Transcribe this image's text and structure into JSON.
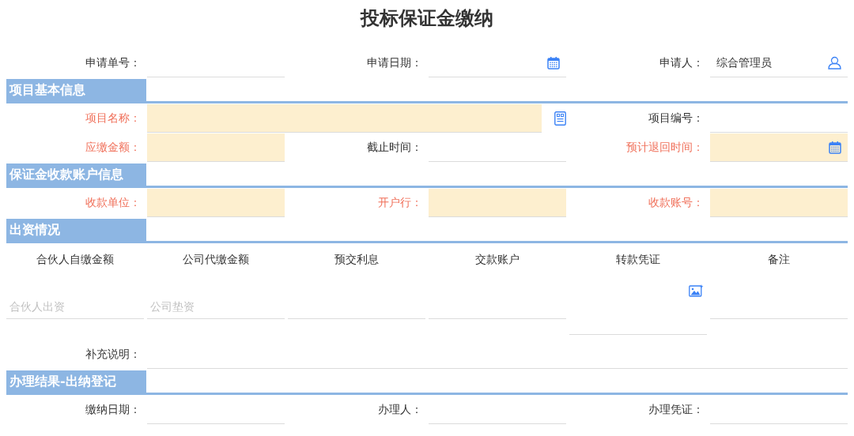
{
  "title": "投标保证金缴纳",
  "top_rows": [
    [
      {
        "label": "申请单号：",
        "required": false,
        "kind": "text"
      },
      {
        "label": "申请日期：",
        "required": false,
        "kind": "date"
      },
      {
        "label": "申请人：",
        "required": false,
        "value": "综合管理员",
        "kind": "person"
      }
    ]
  ],
  "sections": [
    {
      "title": "项目基本信息",
      "rows": [
        [
          {
            "label": "项目名称：",
            "required": true,
            "kind": "lookup"
          },
          "",
          {
            "label": "项目编号：",
            "required": false,
            "kind": "text"
          }
        ],
        [
          {
            "label": "应缴金额：",
            "required": true,
            "kind": "text"
          },
          {
            "label": "截止时间：",
            "required": false,
            "kind": "text"
          },
          {
            "label": "预计退回时间：",
            "required": true,
            "kind": "date"
          }
        ]
      ]
    },
    {
      "title": "保证金收款账户信息",
      "rows": [
        [
          {
            "label": "收款单位：",
            "required": true,
            "kind": "text"
          },
          {
            "label": "开户行：",
            "required": true,
            "kind": "text"
          },
          {
            "label": "收款账号：",
            "required": true,
            "kind": "text"
          }
        ]
      ]
    },
    {
      "title": "出资情况",
      "table": {
        "columns": [
          "合伙人自缴金额",
          "公司代缴金额",
          "预交利息",
          "交款账户",
          "转款凭证",
          "备注"
        ],
        "cells": [
          {
            "kind": "input",
            "placeholder": "合伙人出资"
          },
          {
            "kind": "input",
            "placeholder": "公司垫资"
          },
          {
            "kind": "input"
          },
          {
            "kind": "input"
          },
          {
            "kind": "upload"
          },
          {
            "kind": "input"
          }
        ]
      },
      "rows": [
        [
          {
            "label": "补充说明：",
            "required": false,
            "kind": "text"
          },
          "",
          ""
        ]
      ]
    },
    {
      "title": "办理结果-出纳登记",
      "rows": [
        [
          {
            "label": "缴纳日期：",
            "required": false,
            "kind": "text"
          },
          {
            "label": "办理人：",
            "required": false,
            "kind": "text"
          },
          {
            "label": "办理凭证：",
            "required": false,
            "kind": "text"
          }
        ]
      ]
    }
  ]
}
